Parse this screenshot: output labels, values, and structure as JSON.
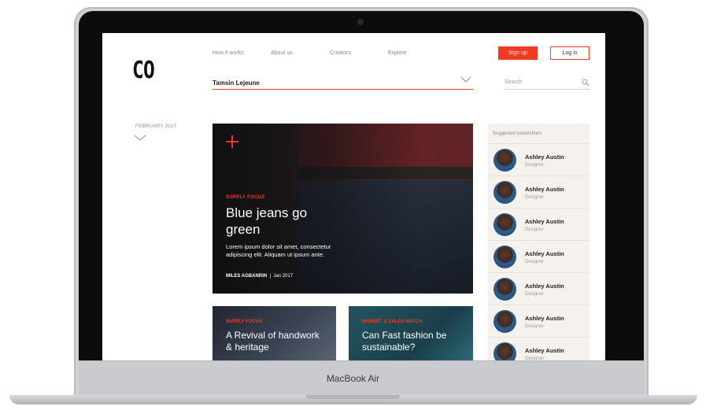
{
  "device": {
    "label": "MacBook Air"
  },
  "logo": "CO",
  "nav": [
    "How it works",
    "About us",
    "Creators",
    "Explore"
  ],
  "actions": {
    "signup": "Sign up",
    "login": "Log in"
  },
  "user_select": {
    "value": "Tamsin Lejeune"
  },
  "search": {
    "placeholder": "Search"
  },
  "date_filter": "FEBRUARY 2017",
  "hero": {
    "category": "SUPPLY FOCUS",
    "title": "Blue jeans go green",
    "body": "Lorem ipsum dolor sit amet, consectetur adipiscing elit. Aliquam ut ipsum ante.",
    "author": "MILES AGBANRIN",
    "date": "Jan 2017"
  },
  "cards": [
    {
      "category": "SUPPLY FOCUS",
      "title": "A Revival of handwork & heritage"
    },
    {
      "category": "MARKET & SALES WATCH",
      "title": "Can Fast fashion be sustainable?"
    }
  ],
  "suggested": {
    "title": "Suggested connections",
    "items": [
      {
        "name": "Ashley Austin",
        "role": "Designer"
      },
      {
        "name": "Ashley Austin",
        "role": "Designer"
      },
      {
        "name": "Ashley Austin",
        "role": "Designer"
      },
      {
        "name": "Ashley Austin",
        "role": "Designer"
      },
      {
        "name": "Ashley Austin",
        "role": "Designer"
      },
      {
        "name": "Ashley Austin",
        "role": "Designer"
      },
      {
        "name": "Ashley Austin",
        "role": "Designer"
      }
    ]
  },
  "colors": {
    "accent": "#ef3b24",
    "sidebar_bg": "#f5f1ec"
  }
}
